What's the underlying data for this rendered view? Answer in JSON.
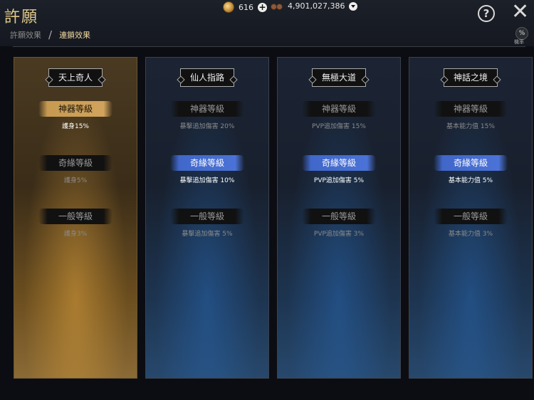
{
  "header": {
    "title": "許願",
    "gold_amount": "616",
    "silver_amount": "4,901,027,386",
    "rate_label": "機率"
  },
  "tabs": [
    {
      "label": "許願效果"
    },
    {
      "label": "連鎖效果"
    }
  ],
  "tab_separator": "/",
  "rate_icon": "%",
  "cards": [
    {
      "title": "天上奇人",
      "theme": "gold",
      "tiers": [
        {
          "label": "神器等級",
          "desc": "護身15%",
          "active": true
        },
        {
          "label": "奇緣等級",
          "desc": "護身5%",
          "active": false
        },
        {
          "label": "一般等級",
          "desc": "護身3%",
          "active": false
        }
      ]
    },
    {
      "title": "仙人指路",
      "theme": "blue",
      "tiers": [
        {
          "label": "神器等級",
          "desc": "暴擊追加傷害 20%",
          "active": false
        },
        {
          "label": "奇緣等級",
          "desc": "暴擊追加傷害 10%",
          "active": true
        },
        {
          "label": "一般等級",
          "desc": "暴擊追加傷害 5%",
          "active": false
        }
      ]
    },
    {
      "title": "無極大道",
      "theme": "blue",
      "tiers": [
        {
          "label": "神器等級",
          "desc": "PVP追加傷害 15%",
          "active": false
        },
        {
          "label": "奇緣等級",
          "desc": "PVP追加傷害 5%",
          "active": true
        },
        {
          "label": "一般等級",
          "desc": "PVP追加傷害 3%",
          "active": false
        }
      ]
    },
    {
      "title": "神話之境",
      "theme": "blue",
      "tiers": [
        {
          "label": "神器等級",
          "desc": "基本能力值 15%",
          "active": false
        },
        {
          "label": "奇緣等級",
          "desc": "基本能力值 5%",
          "active": true
        },
        {
          "label": "一般等級",
          "desc": "基本能力值 3%",
          "active": false
        }
      ]
    }
  ],
  "colors": {
    "gold_accent": "#c79a52",
    "blue_accent": "#4b72d6",
    "title_gold": "#e0c88a"
  }
}
